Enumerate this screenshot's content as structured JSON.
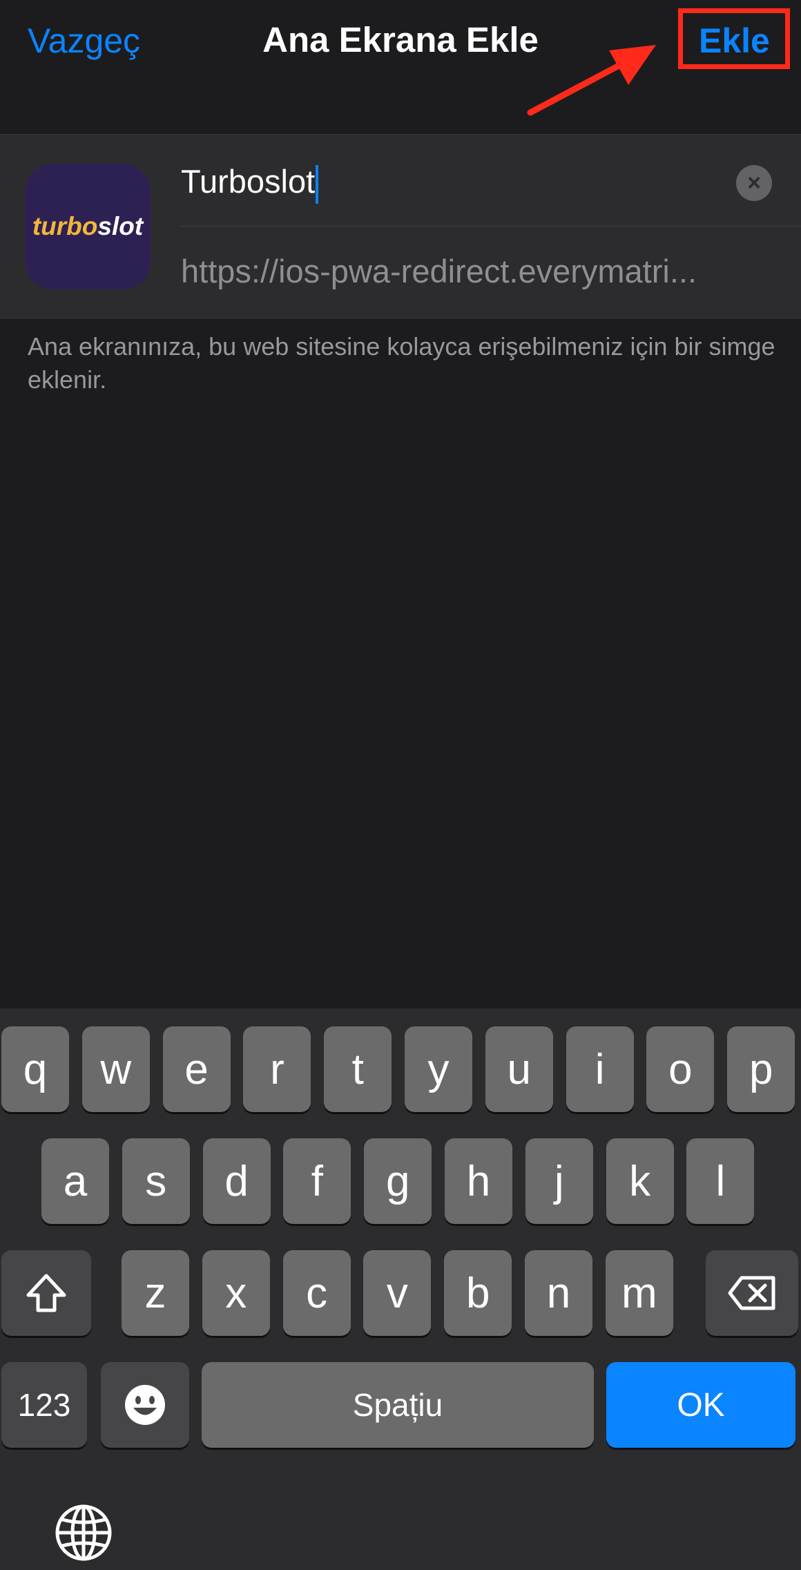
{
  "header": {
    "cancel_label": "Vazgeç",
    "title": "Ana Ekrana Ekle",
    "add_label": "Ekle"
  },
  "app": {
    "icon_text_part1": "turbo",
    "icon_text_part2": "slot",
    "name_value": "Turboslot",
    "url_value": "https://ios-pwa-redirect.everymatri..."
  },
  "description": "Ana ekranınıza, bu web sitesine kolayca erişebilmeniz için bir simge eklenir.",
  "keyboard": {
    "row1": [
      "q",
      "w",
      "e",
      "r",
      "t",
      "y",
      "u",
      "i",
      "o",
      "p"
    ],
    "row2": [
      "a",
      "s",
      "d",
      "f",
      "g",
      "h",
      "j",
      "k",
      "l"
    ],
    "row3": [
      "z",
      "x",
      "c",
      "v",
      "b",
      "n",
      "m"
    ],
    "numbers_label": "123",
    "space_label": "Spațiu",
    "ok_label": "OK",
    "shift_icon": "shift-icon",
    "backspace_icon": "backspace-icon",
    "emoji_icon": "emoji-icon",
    "globe_icon": "globe-icon"
  },
  "colors": {
    "accent": "#0a84ff",
    "highlight": "#ff2a1a",
    "background": "#1c1c1e"
  }
}
